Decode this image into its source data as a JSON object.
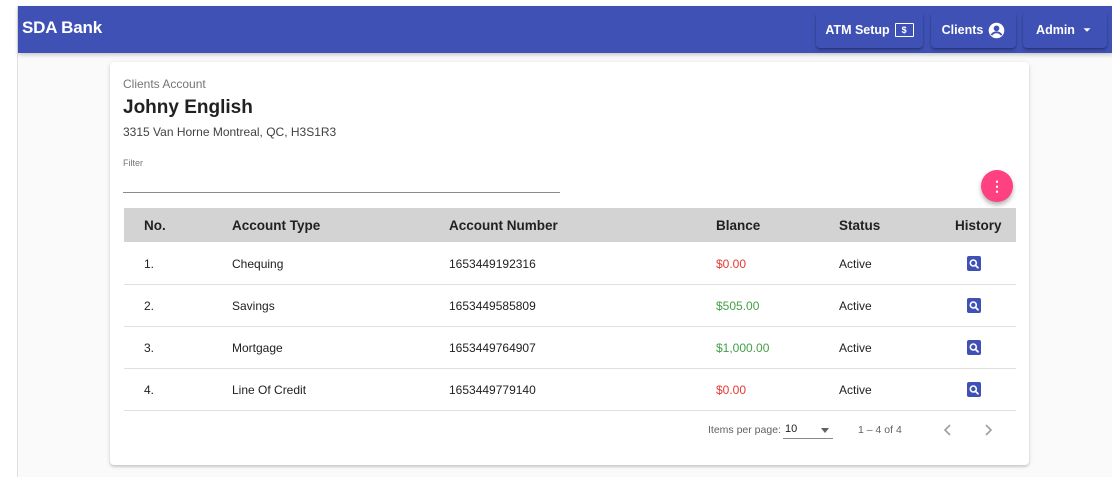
{
  "app": {
    "brand": "SDA Bank"
  },
  "nav": {
    "atm_label": "ATM Setup",
    "atm_icon_text": "$",
    "clients_label": "Clients",
    "admin_label": "Admin"
  },
  "card": {
    "breadcrumb": "Clients Account",
    "client_name": "Johny English",
    "address": "3315 Van Horne Montreal, QC, H3S1R3",
    "filter_label": "Filter",
    "filter_value": "",
    "fab_icon": "⋮"
  },
  "table": {
    "headers": [
      "No.",
      "Account Type",
      "Account Number",
      "Blance",
      "Status",
      "History"
    ],
    "rows": [
      {
        "no": "1.",
        "type": "Chequing",
        "number": "1653449192316",
        "balance": "$0.00",
        "status": "Active"
      },
      {
        "no": "2.",
        "type": "Savings",
        "number": "1653449585809",
        "balance": "$505.00",
        "status": "Active"
      },
      {
        "no": "3.",
        "type": "Mortgage",
        "number": "1653449764907",
        "balance": "$1,000.00",
        "status": "Active"
      },
      {
        "no": "4.",
        "type": "Line Of Credit",
        "number": "1653449779140",
        "balance": "$0.00",
        "status": "Active"
      }
    ]
  },
  "paginator": {
    "items_per_page_label": "Items per page:",
    "items_per_page_value": "10",
    "range": "1 – 4 of 4"
  },
  "colors": {
    "primary": "#3f51b5",
    "accent": "#ff4081",
    "negative": "#e53935",
    "positive": "#43a047"
  },
  "icons": {
    "atm": "dollar-bill-icon",
    "clients": "account-circle-icon",
    "admin": "caret-down-icon",
    "history": "search-history-icon",
    "fab": "more-vert-icon"
  }
}
